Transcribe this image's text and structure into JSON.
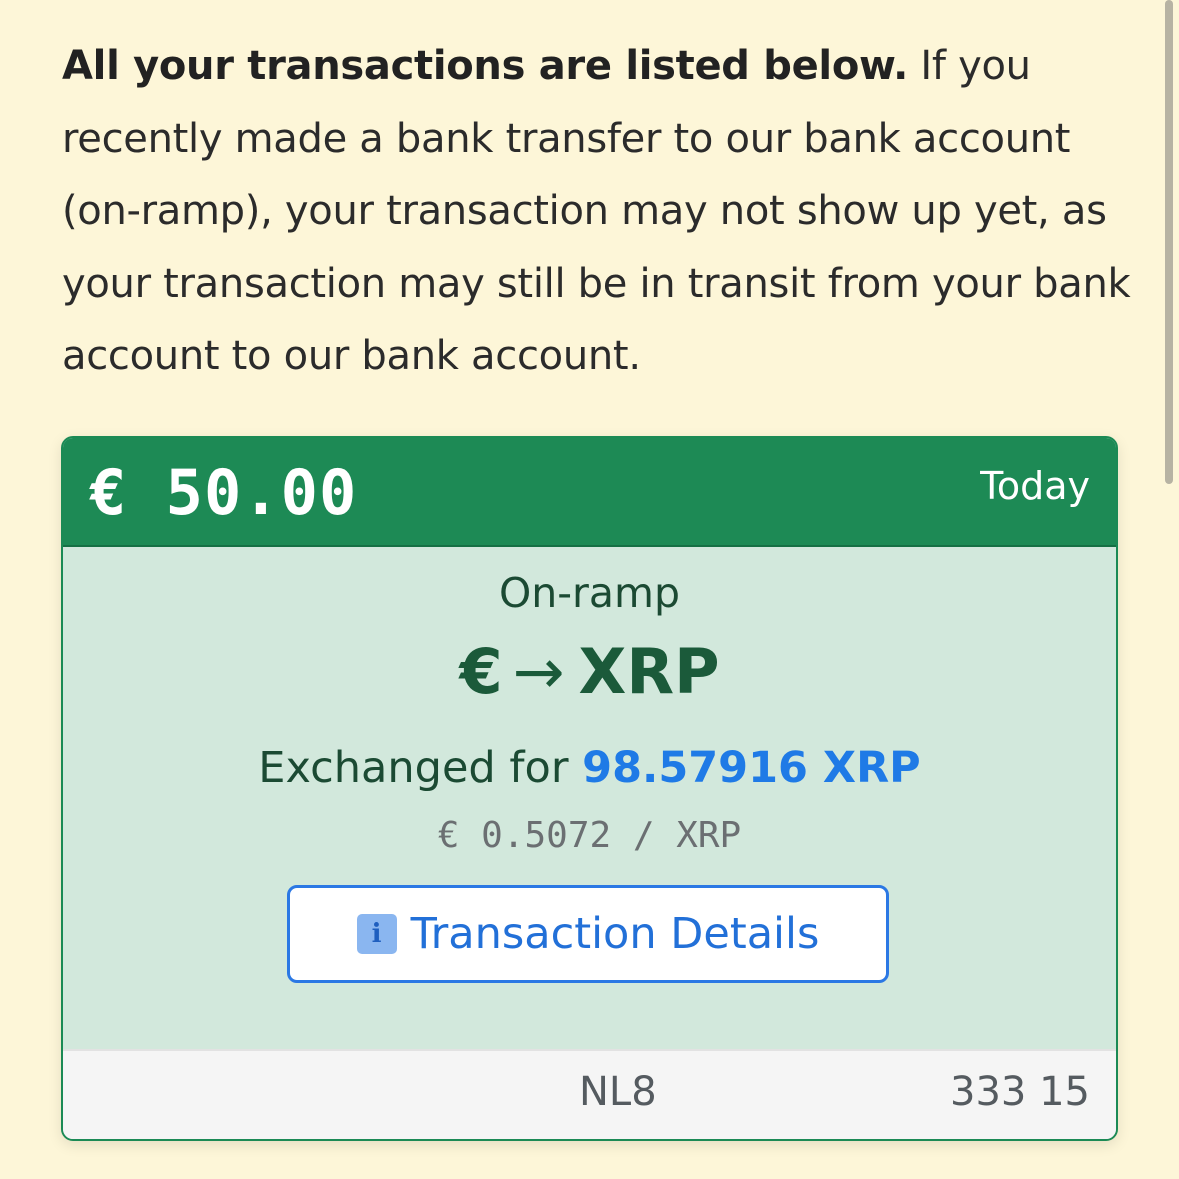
{
  "intro": {
    "bold_text": "All your transactions are listed below.",
    "body_text": " If you recently made a bank transfer to our bank account (on-ramp), your transaction may not show up yet, as your transaction may still be in transit from your bank account to our bank account."
  },
  "transaction": {
    "amount": "€ 50.00",
    "date": "Today",
    "type": "On-ramp",
    "from_symbol": "€",
    "arrow": "→",
    "to_symbol": "XRP",
    "exchanged_prefix": "Exchanged for ",
    "exchanged_value": "98.57916 XRP",
    "rate": "€ 0.5072 / XRP",
    "details_button_label": "Transaction Details",
    "details_icon": "info-icon",
    "iban_start": "NL8",
    "iban_end": "333 15"
  },
  "colors": {
    "page_background": "#fdf6d8",
    "card_header": "#1d8a55",
    "card_body": "#d2e8dc",
    "accent_blue": "#1f7ae6"
  }
}
